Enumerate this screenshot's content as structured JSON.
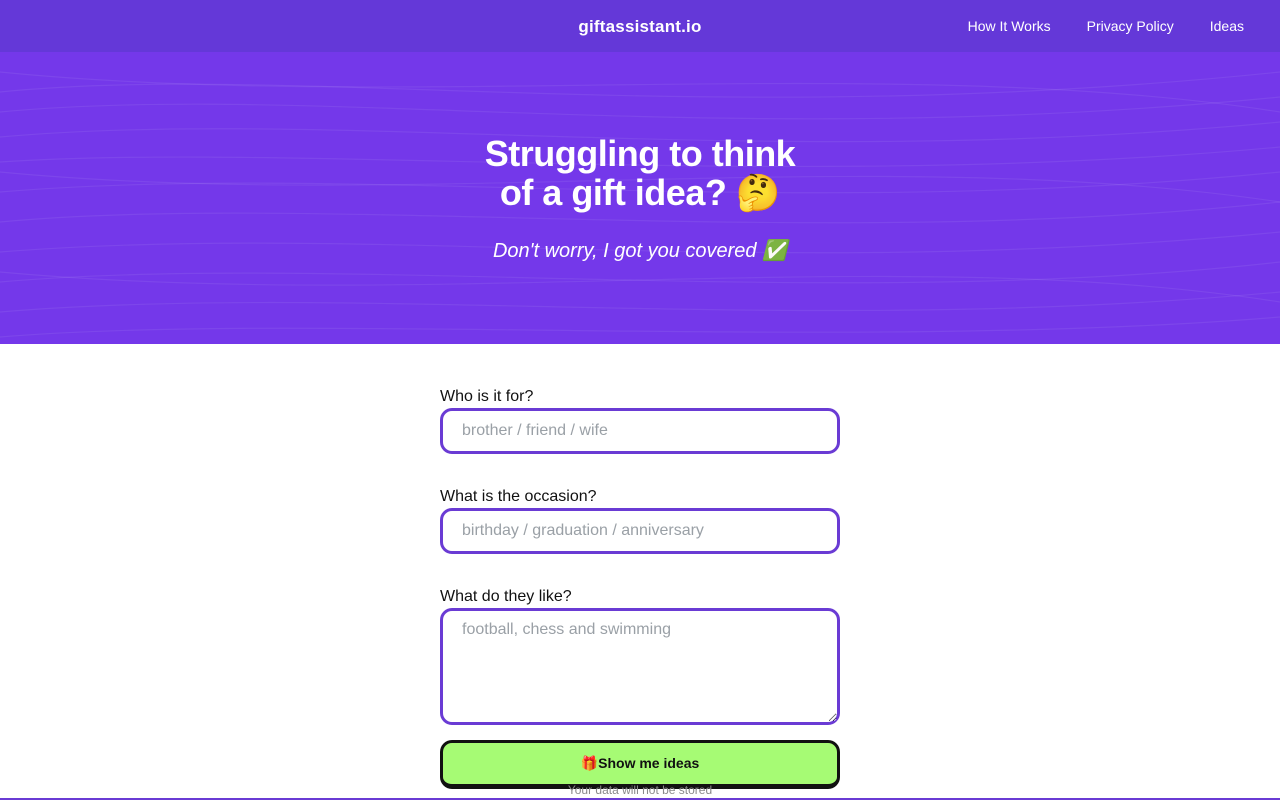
{
  "nav": {
    "brand": "giftassistant.io",
    "links": [
      "How It Works",
      "Privacy Policy",
      "Ideas"
    ]
  },
  "hero": {
    "title_line1": "Struggling to think",
    "title_line2": "of a gift idea? 🤔",
    "subtitle": "Don't worry, I got you covered ✅"
  },
  "form": {
    "recipient": {
      "label": "Who is it for?",
      "placeholder": "brother / friend / wife",
      "value": ""
    },
    "occasion": {
      "label": "What is the occasion?",
      "placeholder": "birthday / graduation / anniversary",
      "value": ""
    },
    "interests": {
      "label": "What do they like?",
      "placeholder": "football, chess and swimming",
      "value": ""
    },
    "submit_label": "🎁Show me ideas",
    "privacy_note": "Your data will not be stored"
  },
  "colors": {
    "navbar": "#6438d8",
    "hero": "#7438ea",
    "input_border": "#6a3bd4",
    "button_bg": "#a6fb74",
    "button_border": "#111111"
  }
}
